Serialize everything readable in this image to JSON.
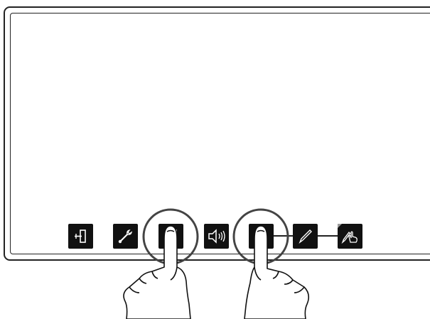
{
  "display": {
    "state": "idle"
  },
  "toolbar": {
    "buttons": [
      {
        "id": "input",
        "icon": "input-source-icon"
      },
      {
        "id": "settings",
        "icon": "wrench-icon"
      },
      {
        "id": "touch-toggle",
        "icon": "touch-door-icon"
      },
      {
        "id": "volume",
        "icon": "speaker-volume-icon"
      },
      {
        "id": "pen-mode",
        "icon": "pen-tip-icon"
      },
      {
        "id": "pen",
        "icon": "pen-icon"
      },
      {
        "id": "touch-pen",
        "icon": "pen-touch-icon"
      }
    ]
  },
  "gesture": {
    "type": "two-finger-press",
    "targets": [
      "touch-toggle",
      "pen-mode"
    ]
  },
  "colors": {
    "button": "#111111",
    "outline": "#222222",
    "icon": "#ffffff",
    "background": "#ffffff"
  }
}
